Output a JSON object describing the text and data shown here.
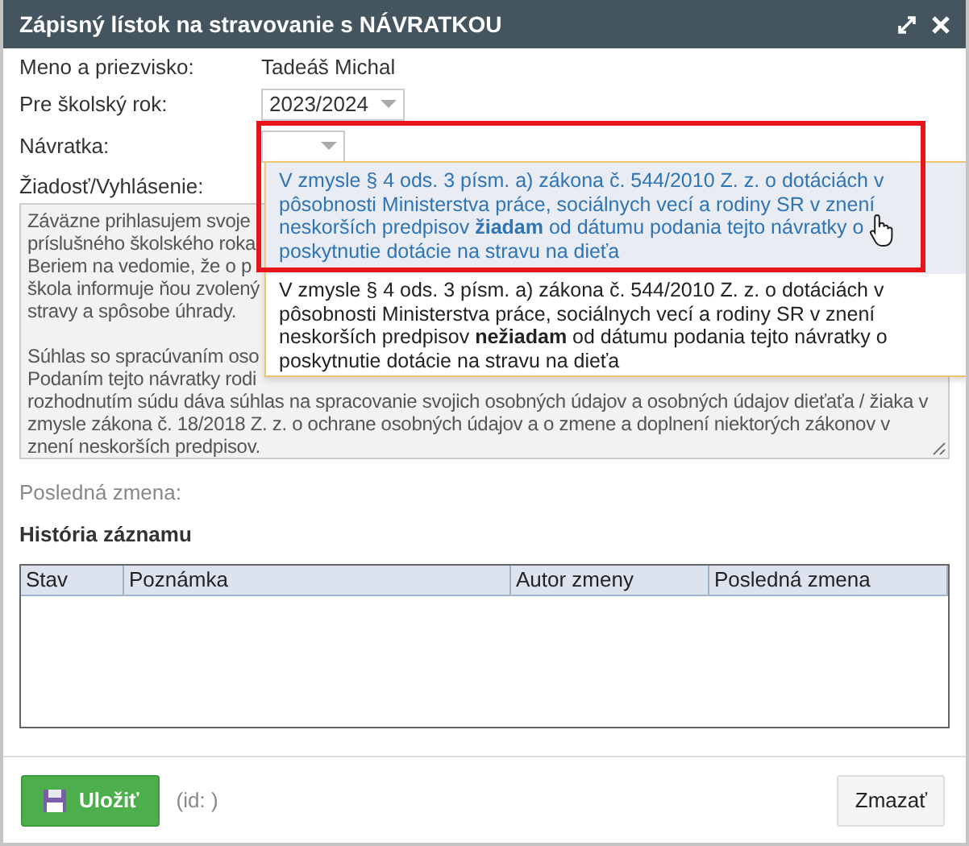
{
  "window": {
    "title": "Zápisný lístok na stravovanie s NÁVRATKOU"
  },
  "fields": [
    {
      "label": "Meno a priezvisko:",
      "kind": "text",
      "value": "Tadeáš Michal"
    },
    {
      "label": "Pre školský rok:",
      "kind": "select",
      "value": "2023/2024"
    },
    {
      "label": "Návratka:",
      "kind": "select"
    }
  ],
  "dropdown_options": [
    {
      "text": "V zmysle § 4 ods. 3 písm. a) zákona č. 544/2010 Z. z. o dotáciách v pôsobnosti Ministerstva práce, sociálnych vecí a rodiny SR v znení neskorších predpisov **žiadam** od dátumu podania tejto návratky o poskytnutie dotácie na stravu na dieťa",
      "highlighted": true
    },
    {
      "text": "V zmysle § 4 ods. 3 písm. a) zákona č. 544/2010 Z. z. o dotáciách v pôsobnosti Ministerstva práce, sociálnych vecí a rodiny SR v znení neskorších predpisov **nežiadam** od dátumu podania tejto návratky o poskytnutie dotácie na stravu na dieťa",
      "highlighted": false
    }
  ],
  "request": {
    "label": "Žiadosť/Vyhlásenie:",
    "paragraphs": [
      [
        "Záväzne prihlasujem svoje",
        "príslušného školského roka",
        "Beriem na vedomie, že o p",
        "škola informuje ňou zvolený",
        "stravy a spôsobe úhrady."
      ],
      [
        "Súhlas so spracúvaním oso",
        "Podaním tejto návratky rodi",
        "rozhodnutím súdu dáva súhlas na spracovanie svojich osobných údajov a osobných údajov dieťaťa / žiaka v",
        "zmysle zákona č. 18/2018 Z. z. o ochrane osobných údajov a o zmene a doplnení niektorých zákonov v",
        "znení neskorších predpisov."
      ]
    ]
  },
  "last_change": {
    "label": "Posledná zmena:"
  },
  "history": {
    "title": "História záznamu",
    "columns": [
      "Stav",
      "Poznámka",
      "Autor zmeny",
      "Posledná zmena"
    ]
  },
  "footer": {
    "save": "Uložiť",
    "id_text": "(id: )",
    "delete": "Zmazať"
  },
  "highlight_frame": true
}
